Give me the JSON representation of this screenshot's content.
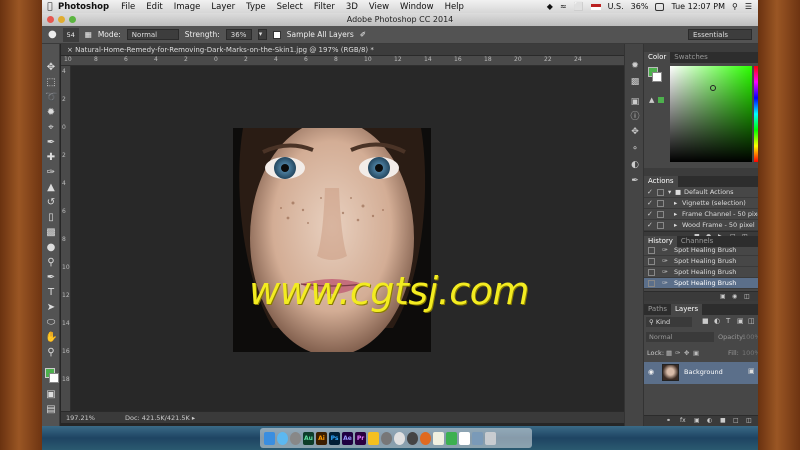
{
  "menubar": {
    "app": "Photoshop",
    "items": [
      "File",
      "Edit",
      "Image",
      "Layer",
      "Type",
      "Select",
      "Filter",
      "3D",
      "View",
      "Window",
      "Help"
    ],
    "battery": "36%",
    "locale": "U.S.",
    "clock": "Tue 12:07 PM"
  },
  "window": {
    "title": "Adobe Photoshop CC 2014"
  },
  "options": {
    "brush_size": "54",
    "mode_label": "Mode:",
    "mode_value": "Normal",
    "strength_label": "Strength:",
    "strength_value": "36%",
    "sample_all_label": "Sample All Layers",
    "workspace": "Essentials"
  },
  "document": {
    "tab_title": "Natural-Home-Remedy-for-Removing-Dark-Marks-on-the-Skin1.jpg @ 197% (RGB/8) *",
    "zoom": "197.21%",
    "doc_size": "Doc: 421.5K/421.5K",
    "ruler_h": [
      "10",
      "8",
      "6",
      "4",
      "2",
      "0",
      "2",
      "4",
      "6",
      "8",
      "10",
      "12",
      "14",
      "16",
      "18",
      "20",
      "22",
      "24"
    ],
    "ruler_v": [
      "4",
      "2",
      "0",
      "2",
      "4",
      "6",
      "8",
      "10",
      "12",
      "14",
      "16",
      "18"
    ]
  },
  "watermark": "www.cgtsj.com",
  "panels": {
    "color": {
      "tabs": [
        "Color",
        "Swatches"
      ],
      "fg": "#4db04d"
    },
    "actions": {
      "tabs": [
        "Actions"
      ],
      "items": [
        "Default Actions",
        "Vignette (selection)",
        "Frame Channel - 50 pixel",
        "Wood Frame - 50 pixel"
      ]
    },
    "history": {
      "tabs": [
        "History",
        "Channels"
      ],
      "items": [
        "Spot Healing Brush",
        "Spot Healing Brush",
        "Spot Healing Brush",
        "Spot Healing Brush"
      ]
    },
    "layers": {
      "tabs": [
        "Paths",
        "Layers"
      ],
      "filter": "Kind",
      "blend": "Normal",
      "opacity_label": "Opacity:",
      "opacity": "100%",
      "lock_label": "Lock:",
      "fill_label": "Fill:",
      "fill": "100%",
      "layer_name": "Background"
    }
  }
}
